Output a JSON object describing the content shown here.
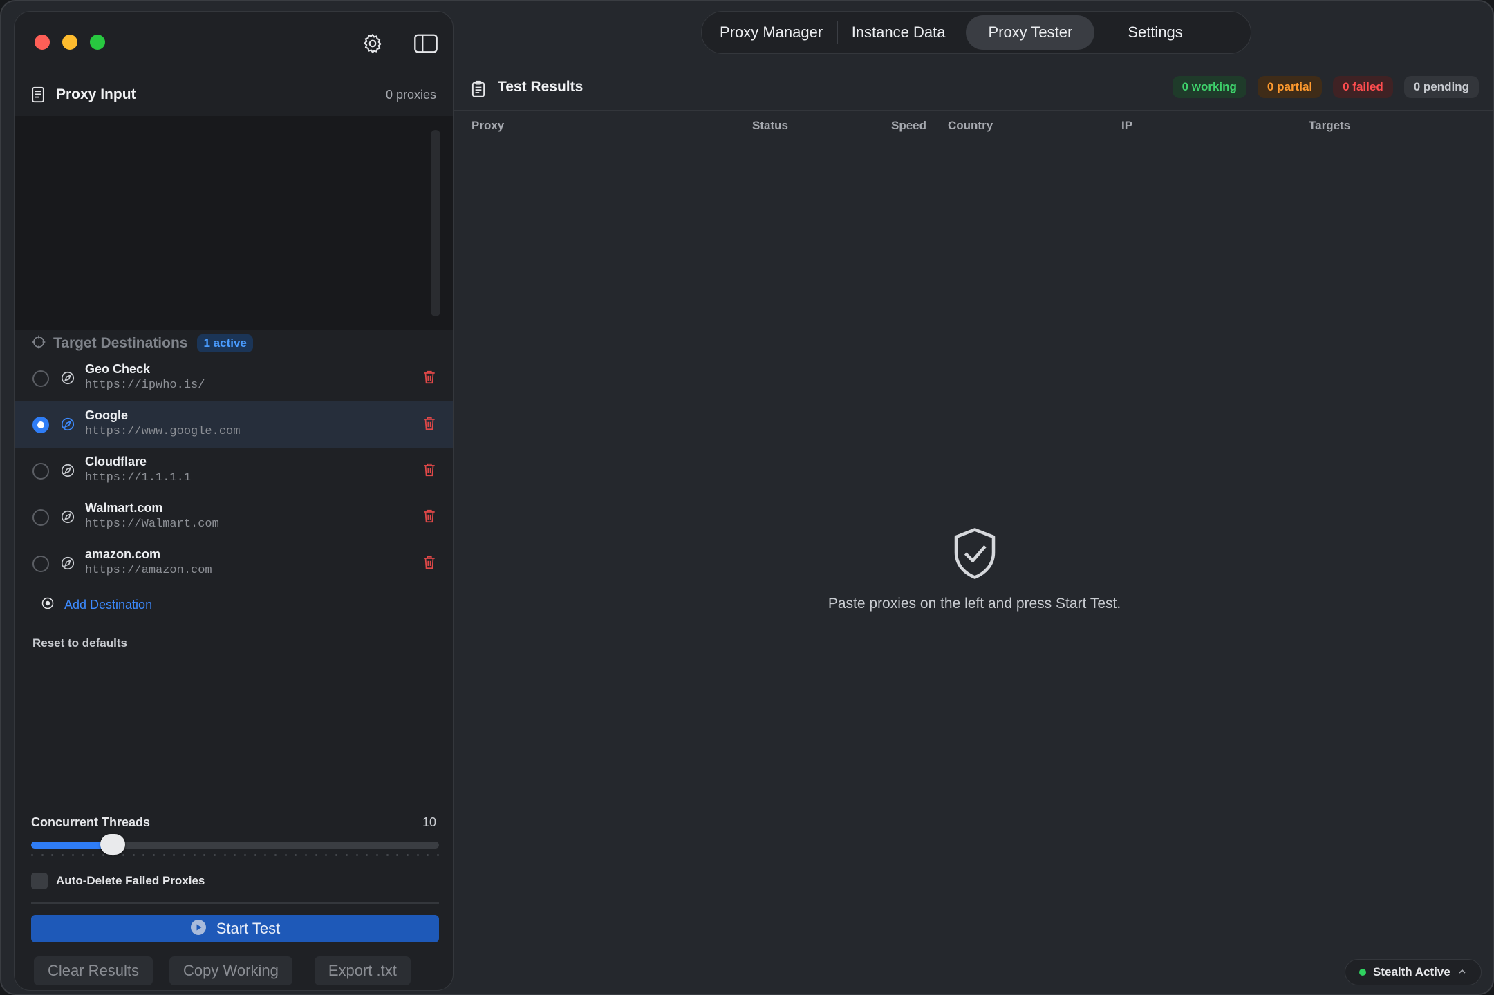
{
  "sidebar": {
    "proxy_input": {
      "title": "Proxy Input",
      "count": "0 proxies",
      "placeholder": ""
    },
    "targets": {
      "title": "Target Destinations",
      "active_badge": "1 active",
      "items": [
        {
          "name": "Geo Check",
          "url": "https://ipwho.is/",
          "selected": false
        },
        {
          "name": "Google",
          "url": "https://www.google.com",
          "selected": true
        },
        {
          "name": "Cloudflare",
          "url": "https://1.1.1.1",
          "selected": false
        },
        {
          "name": "Walmart.com",
          "url": "https://Walmart.com",
          "selected": false
        },
        {
          "name": "amazon.com",
          "url": "https://amazon.com",
          "selected": false
        }
      ],
      "add_label": "Add Destination",
      "reset_label": "Reset to defaults"
    },
    "threads": {
      "label": "Concurrent Threads",
      "value": "10",
      "fraction": 0.2
    },
    "auto_delete_label": "Auto-Delete Failed Proxies",
    "start_label": "Start Test",
    "clear_label": "Clear Results",
    "copy_label": "Copy Working",
    "export_label": "Export .txt"
  },
  "tabs": [
    {
      "label": "Proxy Manager",
      "active": false
    },
    {
      "label": "Instance Data",
      "active": false
    },
    {
      "label": "Proxy Tester",
      "active": true
    },
    {
      "label": "Settings",
      "active": false
    }
  ],
  "results": {
    "title": "Test Results",
    "pills": {
      "working": "0 working",
      "partial": "0 partial",
      "failed": "0 failed",
      "pending": "0 pending"
    },
    "columns": [
      "Proxy",
      "Status",
      "Speed",
      "Country",
      "IP",
      "Targets"
    ],
    "empty_message": "Paste proxies on the left and press Start Test."
  },
  "status": {
    "stealth_label": "Stealth Active"
  },
  "colors": {
    "accent": "#2f7df6",
    "working": "#3ed16b",
    "partial": "#ff9a2e",
    "failed": "#ff4d4f",
    "trash": "#e04848"
  }
}
